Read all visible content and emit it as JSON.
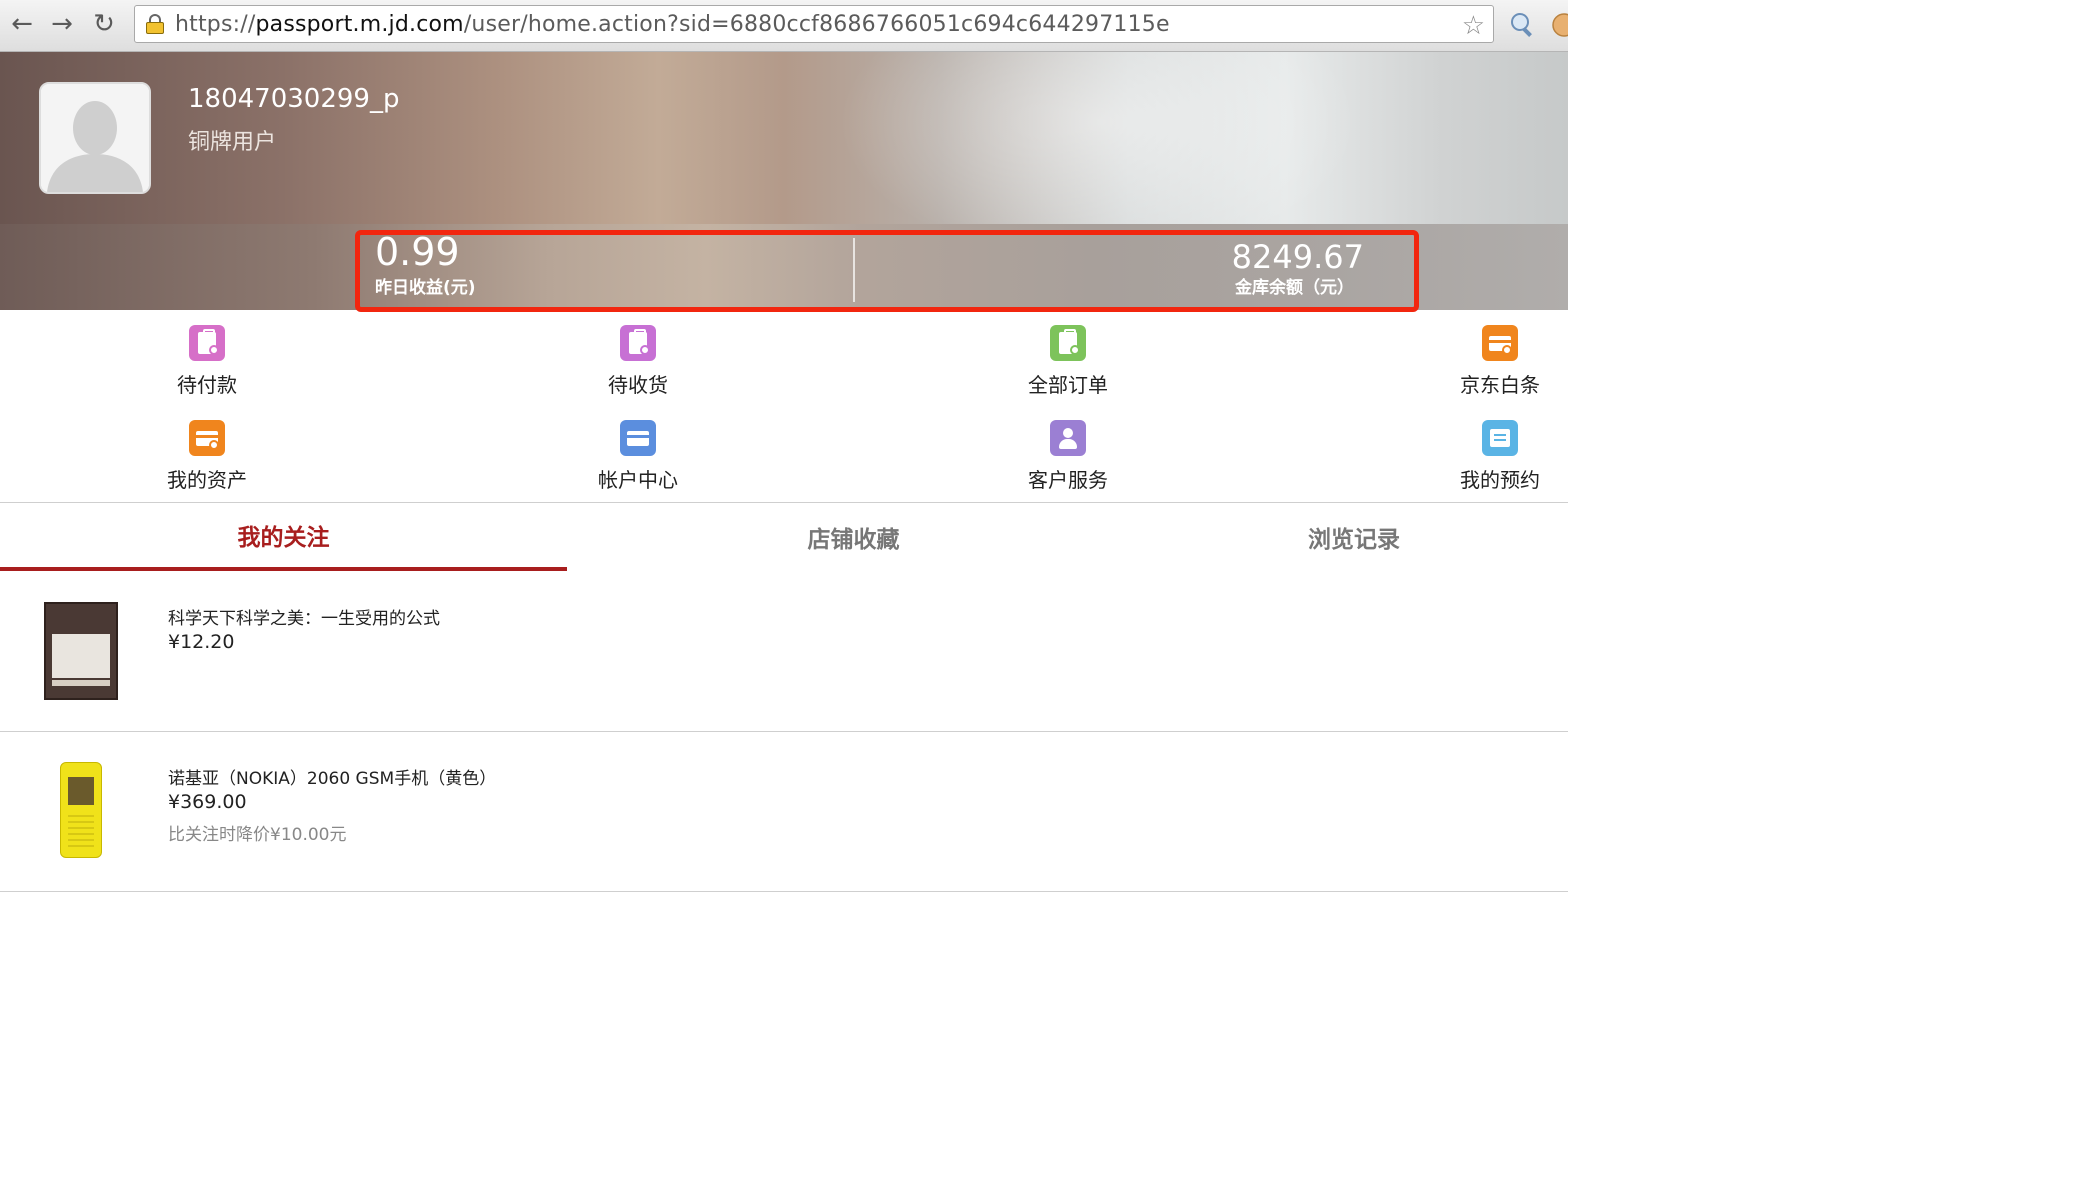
{
  "browser": {
    "url_scheme": "https://",
    "url_host": "passport.m.jd.com",
    "url_path": "/user/home.action?sid=6880ccf8686766051c694c644297115e",
    "back_icon": "←",
    "forward_icon": "→",
    "reload_icon": "↻",
    "star_icon": "☆"
  },
  "profile": {
    "username": "18047030299_p",
    "level": "铜牌用户"
  },
  "stats": {
    "yesterday_value": "0.99",
    "yesterday_label": "昨日收益(元)",
    "balance_value": "8249.67",
    "balance_label": "金库余额（元）"
  },
  "menu": {
    "pending_payment": "待付款",
    "pending_receipt": "待收货",
    "all_orders": "全部订单",
    "jd_baitiao": "京东白条",
    "my_assets": "我的资产",
    "account_center": "帐户中心",
    "customer_service": "客户服务",
    "my_reservations": "我的预约"
  },
  "tabs": {
    "my_follows": "我的关注",
    "shop_favorites": "店铺收藏",
    "history": "浏览记录"
  },
  "products": [
    {
      "title": "科学天下科学之美：一生受用的公式",
      "price": "¥12.20"
    },
    {
      "title": "诺基亚（NOKIA）2060 GSM手机（黄色）",
      "price": "¥369.00",
      "note": "比关注时降价¥10.00元"
    }
  ],
  "colors": {
    "accent": "#a81e1e",
    "highlight_border": "#f2260f",
    "icon_pink": "#d66fc8",
    "icon_green": "#7dc35b",
    "icon_orange": "#f0851d",
    "icon_blue": "#5b8ede",
    "icon_purple": "#9b7fd3",
    "icon_lightblue": "#5ab4e5"
  }
}
